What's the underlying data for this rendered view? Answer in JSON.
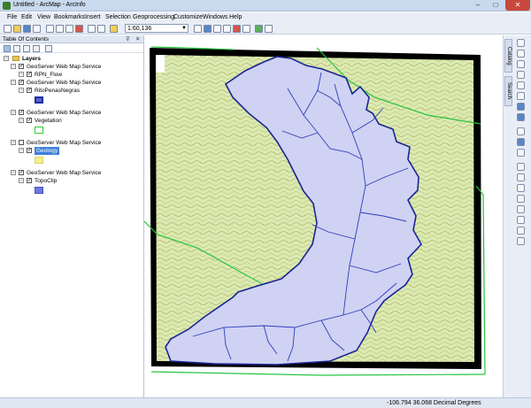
{
  "window": {
    "title": "Untitled - ArcMap - ArcInfo"
  },
  "menu": [
    "File",
    "Edit",
    "View",
    "Bookmarks",
    "Insert",
    "Selection",
    "Geoprocessing",
    "Customize",
    "Windows",
    "Help"
  ],
  "toolbar": {
    "scale": "1:60,136"
  },
  "toc": {
    "title": "Table Of Contents",
    "root": "Layers",
    "services": [
      {
        "name": "GeoServer Web Map Service",
        "layer": "RPN_Flow",
        "color": ""
      },
      {
        "name": "GeoServer Web Map Service",
        "layer": "RitoPenasNegras",
        "color": "#1d2e9e"
      },
      {
        "name": "GeoServer Web Map Service",
        "layer": "Vegetation",
        "color": "#35c735"
      },
      {
        "name": "GeoServer Web Map Service",
        "layer": "Geology",
        "color": "#f4f08a"
      },
      {
        "name": "GeoServer Web Map Service",
        "layer": "TopoClip",
        "color": "#6f78e0"
      }
    ]
  },
  "side_tabs": [
    "Catalog",
    "Search"
  ],
  "status": {
    "coordinates": "-106.794  36.068 Decimal Degrees"
  },
  "colors": {
    "topo_background": "#d9ebb0",
    "topo_lines": "#b59a5b",
    "watershed_fill": "#cfd2f2",
    "watershed_outline": "#1a2593",
    "streams": "#2d3ebd",
    "road_lines": "#28c440",
    "frame": "#000000"
  }
}
